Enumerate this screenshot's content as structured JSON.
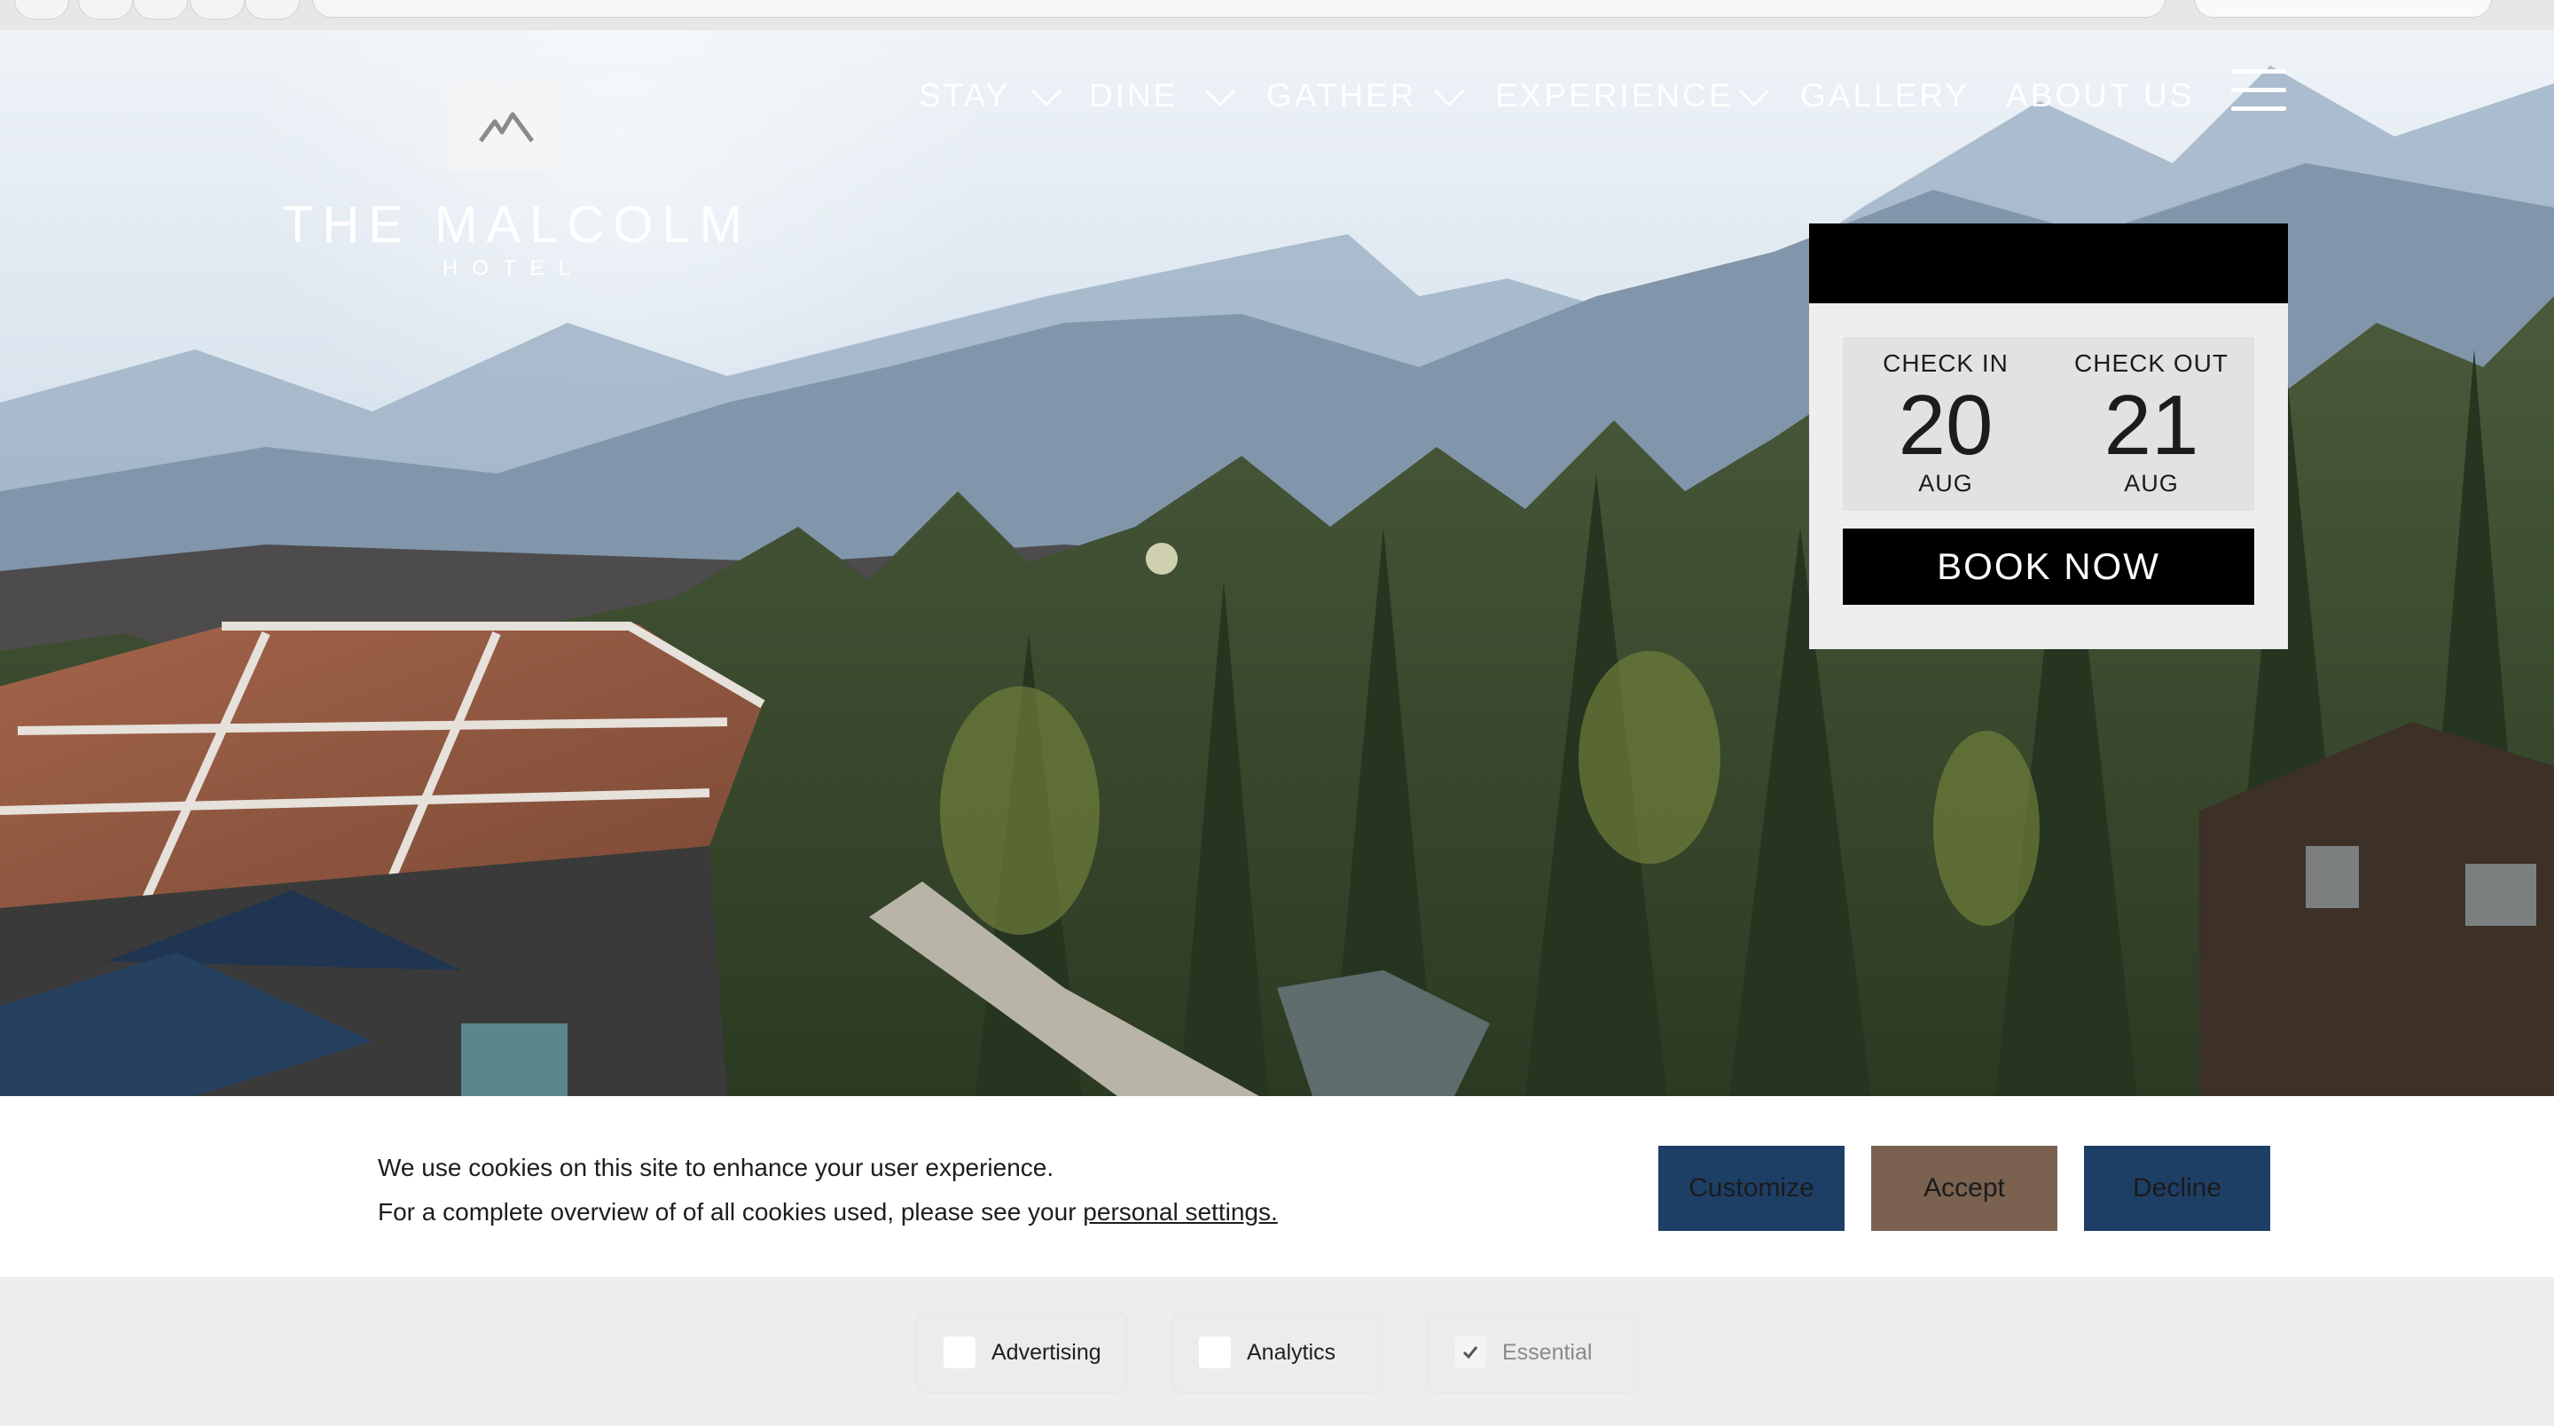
{
  "brand": {
    "name": "THE MALCOLM",
    "sub": "HOTEL"
  },
  "nav": {
    "items": [
      {
        "label": "STAY",
        "dropdown": true
      },
      {
        "label": "DINE",
        "dropdown": true
      },
      {
        "label": "GATHER",
        "dropdown": true
      },
      {
        "label": "EXPERIENCE",
        "dropdown": true
      },
      {
        "label": "GALLERY",
        "dropdown": false
      },
      {
        "label": "ABOUT US",
        "dropdown": false
      }
    ],
    "menu_icon": "hamburger-icon"
  },
  "booking": {
    "check_in": {
      "label": "CHECK IN",
      "day": "20",
      "month": "AUG"
    },
    "check_out": {
      "label": "CHECK OUT",
      "day": "21",
      "month": "AUG"
    },
    "book_label": "BOOK NOW"
  },
  "cookie": {
    "line1": "We use cookies on this site to enhance your user experience.",
    "line2": "For a complete overview of of all cookies used, please see your",
    "link": "personal settings.",
    "buttons": {
      "customize": "Customize",
      "accept": "Accept",
      "decline": "Decline"
    },
    "colors": {
      "customize": "#1d3f66",
      "accept": "#7a6150",
      "decline": "#1d3f66"
    },
    "categories": [
      {
        "label": "Advertising",
        "checked": false,
        "disabled": false
      },
      {
        "label": "Analytics",
        "checked": false,
        "disabled": false
      },
      {
        "label": "Essential",
        "checked": true,
        "disabled": true
      }
    ]
  }
}
